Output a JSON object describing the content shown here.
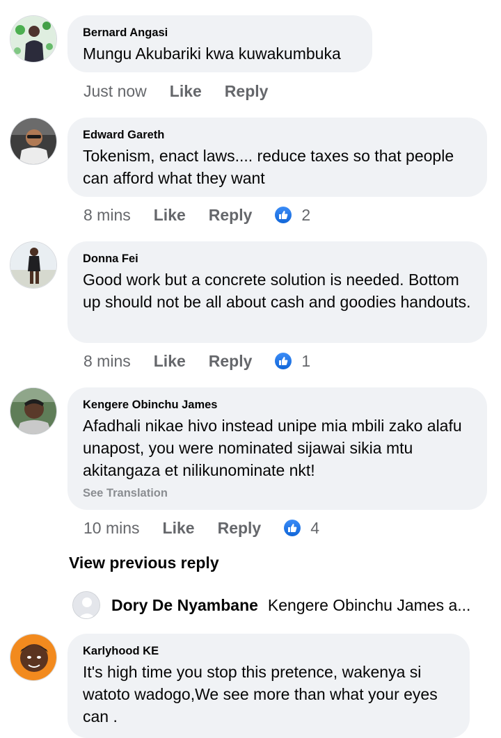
{
  "comments": [
    {
      "author": "Bernard Angasi",
      "text": "Mungu Akubariki kwa kuwakumbuka",
      "time": "Just now",
      "like_label": "Like",
      "reply_label": "Reply",
      "reaction_count": ""
    },
    {
      "author": "Edward Gareth",
      "text": "Tokenism, enact laws.... reduce taxes so that people can afford what they want",
      "time": "8 mins",
      "like_label": "Like",
      "reply_label": "Reply",
      "reaction_count": "2"
    },
    {
      "author": "Donna Fei",
      "text": "Good work but a concrete solution is needed. Bottom up should not be all about cash and goodies handouts.",
      "time": "8 mins",
      "like_label": "Like",
      "reply_label": "Reply",
      "reaction_count": "1"
    },
    {
      "author": "Kengere Obinchu James",
      "text": "Afadhali nikae hivo instead unipe mia mbili zako alafu unapost, you were nominated sijawai sikia mtu akitangaza et nilikunominate nkt!",
      "see_translation": "See Translation",
      "time": "10 mins",
      "like_label": "Like",
      "reply_label": "Reply",
      "reaction_count": "4"
    },
    {
      "author": "Karlyhood KE",
      "text": "It's high time you stop this pretence, wakenya si watoto wadogo,We see more than what your eyes can ."
    }
  ],
  "view_previous_reply": "View previous reply",
  "reply_preview": {
    "author": "Dory De Nyambane",
    "text": "Kengere Obinchu James a..."
  },
  "icons": {
    "like_reaction": "thumbs-up-icon"
  },
  "colors": {
    "bubble": "#f0f2f5",
    "meta_text": "#65676b",
    "like_blue": "#1877f2"
  }
}
